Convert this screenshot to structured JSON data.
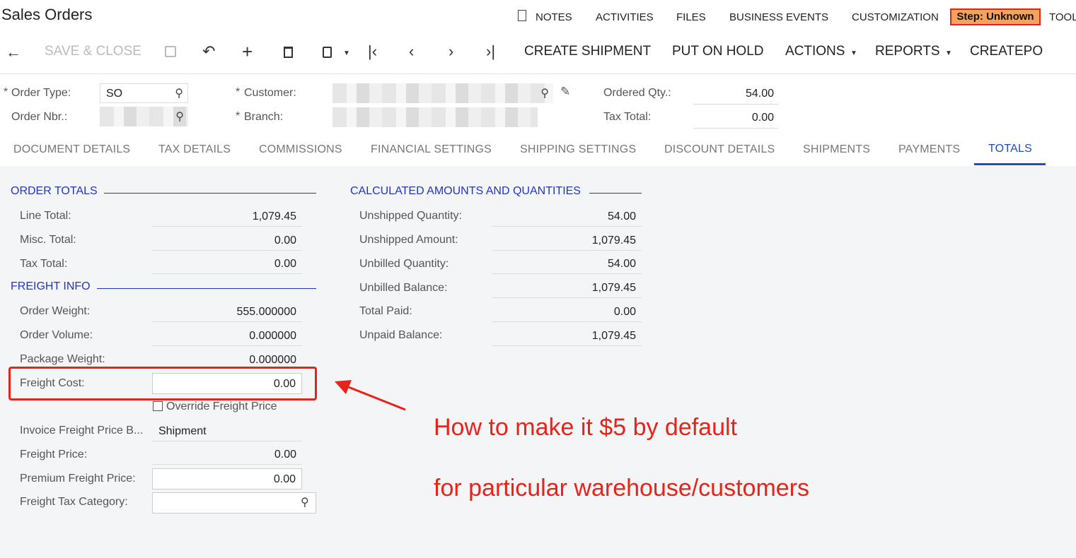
{
  "header": {
    "title": "Sales Orders",
    "links": [
      "NOTES",
      "ACTIVITIES",
      "FILES",
      "BUSINESS EVENTS",
      "CUSTOMIZATION"
    ],
    "step": "Step: Unknown",
    "tools_partial": "TOOL"
  },
  "toolbar": {
    "save_close": "SAVE & CLOSE",
    "create_shipment": "CREATE SHIPMENT",
    "put_on_hold": "PUT ON HOLD",
    "actions": "ACTIONS",
    "reports": "REPORTS",
    "createpo": "CREATEPO",
    "icons": [
      "back-arrow-icon",
      "save-icon",
      "undo-icon",
      "add-icon",
      "delete-icon",
      "copy-paste-icon",
      "first-icon",
      "prev-icon",
      "next-icon",
      "last-icon"
    ]
  },
  "summary": {
    "order_type_label": "Order Type:",
    "order_type_value": "SO",
    "order_nbr_label": "Order Nbr.:",
    "customer_label": "Customer:",
    "branch_label": "Branch:",
    "ordered_qty_label": "Ordered Qty.:",
    "ordered_qty_value": "54.00",
    "tax_total_label": "Tax Total:",
    "tax_total_value": "0.00",
    "required_mark": "*"
  },
  "tabs": [
    "DOCUMENT DETAILS",
    "TAX DETAILS",
    "COMMISSIONS",
    "FINANCIAL SETTINGS",
    "SHIPPING SETTINGS",
    "DISCOUNT DETAILS",
    "SHIPMENTS",
    "PAYMENTS",
    "TOTALS"
  ],
  "order_totals": {
    "title": "ORDER TOTALS",
    "rows": [
      {
        "label": "Line Total:",
        "value": "1,079.45"
      },
      {
        "label": "Misc. Total:",
        "value": "0.00"
      },
      {
        "label": "Tax Total:",
        "value": "0.00"
      }
    ]
  },
  "freight_info": {
    "title": "FREIGHT INFO",
    "order_weight_label": "Order Weight:",
    "order_weight": "555.000000",
    "order_volume_label": "Order Volume:",
    "order_volume": "0.000000",
    "package_weight_label": "Package Weight:",
    "package_weight": "0.000000",
    "freight_cost_label": "Freight Cost:",
    "freight_cost": "0.00",
    "override_label": "Override Freight Price",
    "invoice_basis_label": "Invoice Freight Price B...",
    "invoice_basis": "Shipment",
    "freight_price_label": "Freight Price:",
    "freight_price": "0.00",
    "premium_label": "Premium Freight Price:",
    "premium": "0.00",
    "tax_category_label": "Freight Tax Category:",
    "tax_category": ""
  },
  "calculated": {
    "title": "CALCULATED AMOUNTS AND QUANTITIES",
    "rows": [
      {
        "label": "Unshipped Quantity:",
        "value": "54.00"
      },
      {
        "label": "Unshipped Amount:",
        "value": "1,079.45"
      },
      {
        "label": "Unbilled Quantity:",
        "value": "54.00"
      },
      {
        "label": "Unbilled Balance:",
        "value": "1,079.45"
      },
      {
        "label": "Total Paid:",
        "value": "0.00"
      },
      {
        "label": "Unpaid Balance:",
        "value": "1,079.45"
      }
    ]
  },
  "annotation": {
    "line1": "How to make it $5 by default",
    "line2": "for particular warehouse/customers",
    "color": "#e8231a"
  }
}
